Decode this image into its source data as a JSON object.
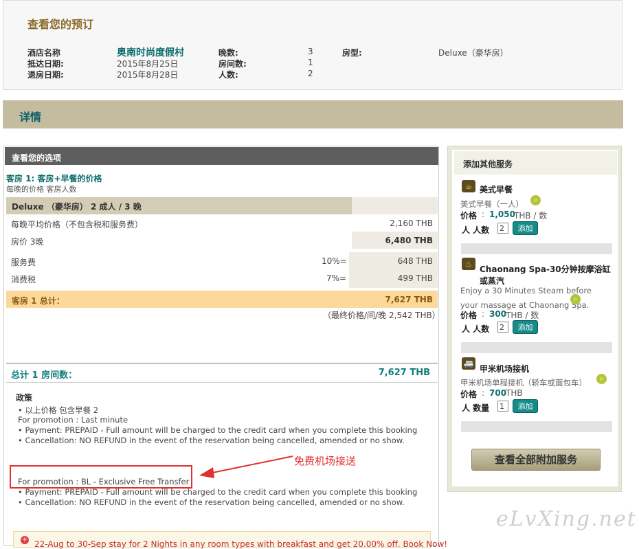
{
  "summary": {
    "title": "查看您的预订",
    "hotel_label": "酒店名称",
    "hotel_name": "奥南时尚度假村",
    "checkin_label": "抵达日期:",
    "checkin_value": "2015年8月25日",
    "checkout_label": "退房日期:",
    "checkout_value": "2015年8月28日",
    "nights_label": "晚数:",
    "nights_value": "3",
    "rooms_label": "房间数:",
    "rooms_value": "1",
    "persons_label": "人数:",
    "persons_value": "2",
    "roomtype_label": "房型:",
    "roomtype_value": "Deluxe（豪华房）"
  },
  "details": {
    "title": "详情"
  },
  "options": {
    "header": "查看您的选项",
    "room_title": "客房 1: 客房+早餐的价格",
    "room_sub": "每晚的价格 客房人数",
    "room_band": "Deluxe （豪华房） 2 成人 / 3 晚",
    "rows": {
      "avg_label": "每晚平均价格（不包含税和服务费）",
      "avg_value": "2,160 THB",
      "price_label": "房价 3晚",
      "price_value": "6,480 THB",
      "service_label": "服务费",
      "service_pct": "10%=",
      "service_value": "648 THB",
      "tax_label": "消费税",
      "tax_pct": "7%=",
      "tax_value": "499 THB"
    },
    "room_total_label": "客房 1 总计：",
    "room_total_value": "7,627 THB",
    "final_per_night_label": "（最终价格/间/晚",
    "final_per_night_value": "2,542 THB）",
    "grand_label": "总计 1  房间数：",
    "grand_value": "7,627 THB"
  },
  "policy": {
    "title": "政策",
    "lines_1": [
      "• 以上价格 包含早餐 2",
      "For promotion : Last minute",
      "• Payment: PREPAID - Full amount will be charged to the credit card when you complete this booking",
      "• Cancellation: NO REFUND in the event of the reservation being cancelled, amended or no show."
    ],
    "promo_line": "For promotion : BL - Exclusive Free Transfer",
    "lines_2": [
      "• Payment: PREPAID - Full amount will be charged to the credit card when you complete this booking",
      "• Cancellation: NO REFUND in the event of the reservation being cancelled, amended or no show."
    ],
    "callout": "免费机场接送"
  },
  "promo_bar": {
    "text": "22-Aug to 30-Sep stay for 2 Nights in any room types with breakfast and get 20.00% off. Book Now!"
  },
  "addons": {
    "title": "添加其他服务",
    "price_label": "价格",
    "add_label": "添加",
    "items": [
      {
        "name": "美式早餐",
        "desc": "美式早餐（一人）",
        "price": "1,050",
        "unit": "THB / 数",
        "qty_label": "人 人数",
        "qty": "2",
        "icon": "breakfast-icon"
      },
      {
        "name": "Chaonang Spa-30分钟按摩浴缸或蒸汽",
        "desc": "Enjoy a 30 Minutes Steam before your massage at Chaonang Spa.",
        "price": "300",
        "unit": "THB / 数",
        "qty_label": "人 人数",
        "qty": "2",
        "icon": "spa-icon"
      },
      {
        "name": "甲米机场接机",
        "desc": "甲米机场单程接机（轿车或面包车）",
        "price": "700",
        "unit": "THB",
        "qty_label": "人 数量",
        "qty": "1",
        "icon": "car-icon"
      }
    ],
    "view_all": "查看全部附加服务"
  },
  "watermark": "eLvXing.net",
  "colors": {
    "accent": "#0e6d6d",
    "band": "#c4bc9f",
    "highlight": "#fcd89a",
    "callout": "#e03030"
  }
}
